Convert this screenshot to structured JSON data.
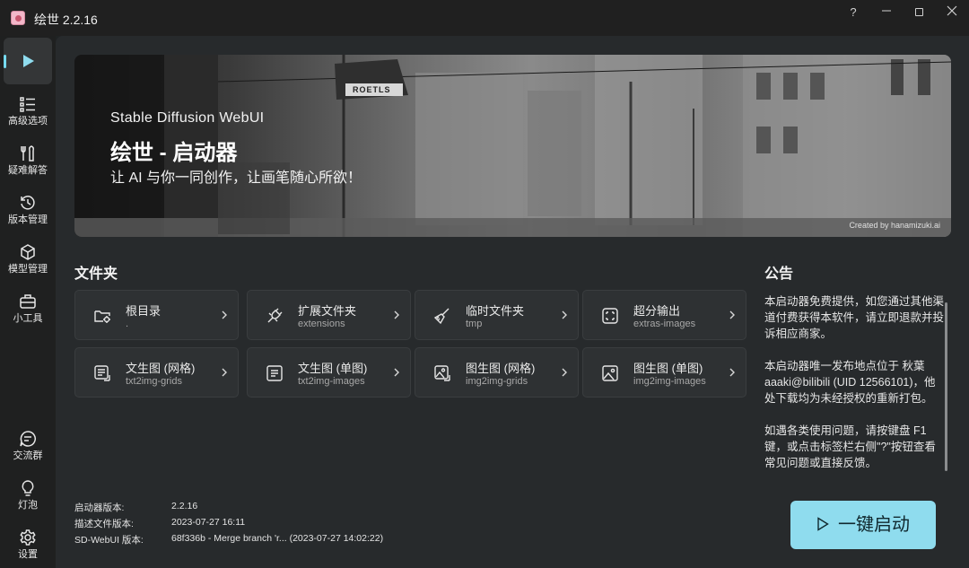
{
  "app": {
    "title": "绘世 2.2.16"
  },
  "window_controls": {
    "help": "?",
    "minimize": "—"
  },
  "sidebar": {
    "items": [
      {
        "label": "",
        "icon": "play-icon"
      },
      {
        "label": "高级选项",
        "icon": "list-icon"
      },
      {
        "label": "疑难解答",
        "icon": "tools-icon"
      },
      {
        "label": "版本管理",
        "icon": "history-icon"
      },
      {
        "label": "模型管理",
        "icon": "cube-icon"
      },
      {
        "label": "小工具",
        "icon": "toolbox-icon"
      },
      {
        "label": "交流群",
        "icon": "chat-icon"
      },
      {
        "label": "灯泡",
        "icon": "bulb-icon"
      },
      {
        "label": "设置",
        "icon": "gear-icon"
      }
    ]
  },
  "banner": {
    "subtitle": "Stable Diffusion WebUI",
    "title": "绘世 - 启动器",
    "slogan": "让 AI 与你一同创作，让画笔随心所欲！",
    "credit": "Created by hanamizuki.ai",
    "sign_text": "ROETLS"
  },
  "folders": {
    "title": "文件夹",
    "items": [
      {
        "title": "根目录",
        "path": ".",
        "icon": "folder-settings-icon"
      },
      {
        "title": "扩展文件夹",
        "path": "extensions",
        "icon": "plug-icon"
      },
      {
        "title": "临时文件夹",
        "path": "tmp",
        "icon": "broom-icon"
      },
      {
        "title": "超分输出",
        "path": "extras-images",
        "icon": "upscale-icon"
      },
      {
        "title": "文生图 (网格)",
        "path": "txt2img-grids",
        "icon": "text-grid-icon"
      },
      {
        "title": "文生图 (单图)",
        "path": "txt2img-images",
        "icon": "text-image-icon"
      },
      {
        "title": "图生图 (网格)",
        "path": "img2img-grids",
        "icon": "image-grid-icon"
      },
      {
        "title": "图生图 (单图)",
        "path": "img2img-images",
        "icon": "image-single-icon"
      }
    ]
  },
  "notice": {
    "title": "公告",
    "paragraphs": [
      "本启动器免费提供，如您通过其他渠道付费获得本软件，请立即退款并投诉相应商家。",
      "本启动器唯一发布地点位于 秋葉aaaki@bilibili (UID 12566101)，他处下载均为未经授权的重新打包。",
      "如遇各类使用问题，请按键盘 F1 键，或点击标签栏右侧\"?\"按钮查看常见问题或直接反馈。"
    ]
  },
  "versions": [
    {
      "key": "启动器版本:",
      "value": "2.2.16"
    },
    {
      "key": "描述文件版本:",
      "value": "2023-07-27 16:11"
    },
    {
      "key": "SD-WebUI 版本:",
      "value": "68f336b - Merge branch 'r... (2023-07-27 14:02:22)"
    }
  ],
  "launch_button": {
    "label": "一键启动"
  },
  "colors": {
    "accent": "#8fdcee",
    "background": "#272a2c",
    "card": "#2e3133",
    "sidebar": "#1f2020"
  }
}
